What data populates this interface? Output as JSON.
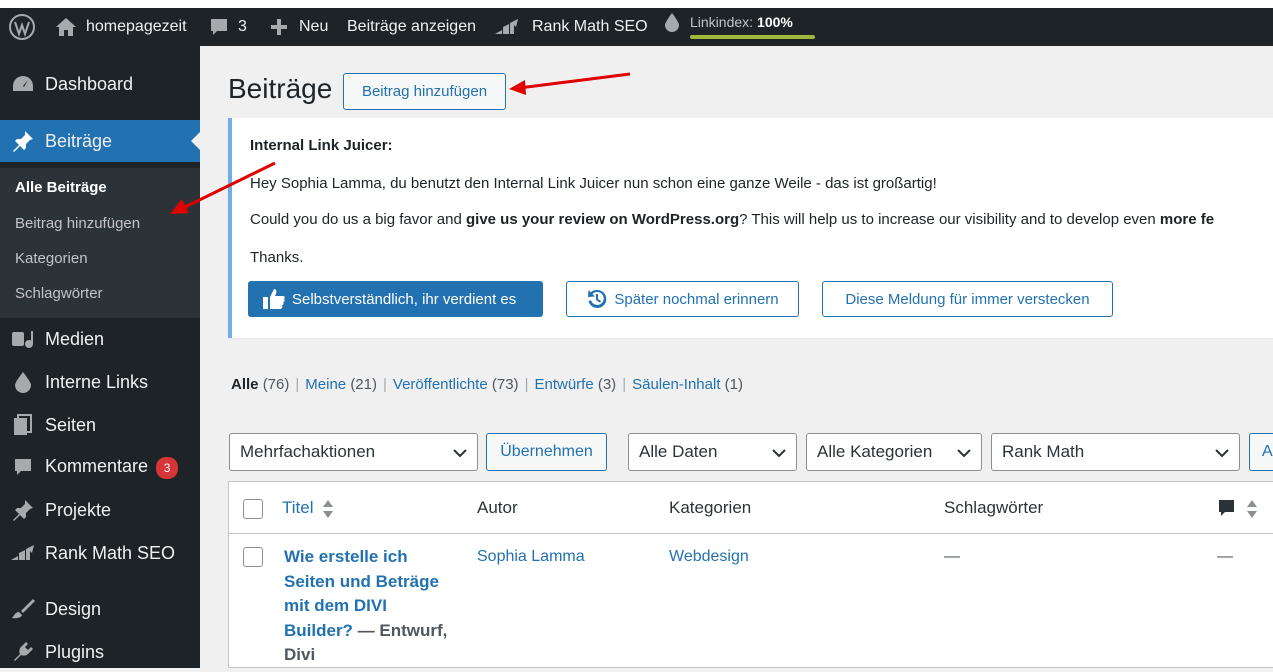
{
  "admin_bar": {
    "site_name": "homepagezeit",
    "comments_count": "3",
    "new_label": "Neu",
    "view_posts": "Beiträge anzeigen",
    "rank_math": "Rank Math SEO",
    "linkindex_label": "Linkindex:",
    "linkindex_value": "100%"
  },
  "sidebar": {
    "dashboard": "Dashboard",
    "posts": "Beiträge",
    "submenu": {
      "all_posts": "Alle Beiträge",
      "add_post": "Beitrag hinzufügen",
      "categories": "Kategorien",
      "tags": "Schlagwörter"
    },
    "media": "Medien",
    "internal_links": "Interne Links",
    "pages": "Seiten",
    "comments": "Kommentare",
    "comments_badge": "3",
    "projects": "Projekte",
    "rank_math": "Rank Math SEO",
    "design": "Design",
    "plugins": "Plugins"
  },
  "header": {
    "title": "Beiträge",
    "add_new_button": "Beitrag hinzufügen"
  },
  "notice": {
    "title": "Internal Link Juicer:",
    "line1": "Hey Sophia Lamma, du benutzt den Internal Link Juicer nun schon eine ganze Weile - das ist großartig!",
    "line2_a": "Could you do us a big favor and ",
    "line2_b": "give us your review on WordPress.org",
    "line2_c": "? This will help us to increase our visibility and to develop even ",
    "line2_d": "more fe",
    "thanks": "Thanks.",
    "btn_yes": "Selbstverständlich, ihr verdient es",
    "btn_later": "Später nochmal erinnern",
    "btn_hide": "Diese Meldung für immer verstecken"
  },
  "filters": {
    "all": "Alle",
    "all_count": "(76)",
    "mine": "Meine",
    "mine_count": "(21)",
    "published": "Veröffentlichte",
    "published_count": "(73)",
    "drafts": "Entwürfe",
    "drafts_count": "(3)",
    "pillar": "Säulen-Inhalt",
    "pillar_count": "(1)",
    "separator": "|"
  },
  "toolbar": {
    "bulk_actions": "Mehrfachaktionen",
    "apply": "Übernehmen",
    "all_dates": "Alle Daten",
    "all_categories": "Alle Kategorien",
    "rank_math": "Rank Math",
    "cut_button": "A"
  },
  "table": {
    "columns": {
      "title": "Titel",
      "author": "Autor",
      "categories": "Kategorien",
      "tags": "Schlagwörter"
    },
    "rows": [
      {
        "title": "Wie erstelle ich Seiten und Beträge mit dem DIVI Builder?",
        "state": "— Entwurf, Divi",
        "author": "Sophia Lamma",
        "category": "Webdesign",
        "tags": "—",
        "comments": "—"
      }
    ]
  },
  "colors": {
    "admin_bg": "#1d2327",
    "accent": "#2271b1",
    "annotation_arrow": "#e00000",
    "linkindex_bar": "#a0b73a"
  }
}
